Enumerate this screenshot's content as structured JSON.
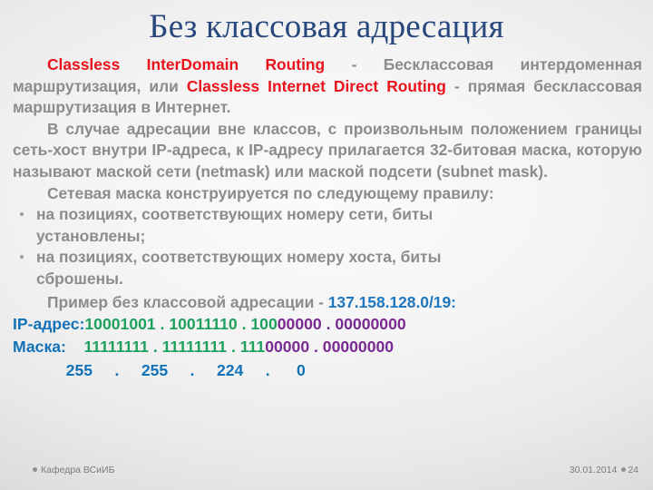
{
  "slide": {
    "title": "Без классовая адресация",
    "paragraphs": [
      {
        "id": "p1",
        "runs": [
          {
            "text": "Classless InterDomain Routing",
            "color": "red"
          },
          {
            "text": " - Бесклассовая интердоменная маршрутизация, или ",
            "color": "gray"
          },
          {
            "text": "Classless Internet Direct Routing",
            "color": "red"
          },
          {
            "text": " - прямая бесклассовая маршрутизация в Интернет.",
            "color": "gray"
          }
        ]
      },
      {
        "id": "p2",
        "text": "В случае адресации вне классов, с произвольным положением границы сеть-хост внутри IP-адреса, к IP-адресу прилагается 32-битовая маска, которую называют маской сети (netmask) или маской подсети (subnet mask)."
      },
      {
        "id": "p3",
        "text": "Сетевая маска конструируется по следующему правилу:"
      }
    ],
    "bullets": [
      {
        "main": "на позициях, соответствующих номеру сети, биты",
        "tail": "установлены;"
      },
      {
        "main": "на позициях, соответствующих номеру хоста, биты",
        "tail": "сброшены."
      }
    ],
    "example": {
      "intro_text": "Пример без классовой адресации - ",
      "intro_address": "137.158.128.0/19:",
      "ip_row": {
        "label": "IP-адрес:",
        "octet1": "10001001",
        "octet2": "10011110",
        "octet3_network": "100",
        "octet3_host": "00000",
        "octet4_host": "00000000",
        "separator": " . "
      },
      "mask_row": {
        "label": "Маска:",
        "octet1": "11111111",
        "octet2": "11111111",
        "octet3_network": "111",
        "octet3_host": "00000",
        "octet4_host": "00000000",
        "separator": " . "
      },
      "decimal_row": {
        "octet1": "255",
        "octet2": "255",
        "octet3": "224",
        "octet4": "0",
        "separator": "."
      }
    },
    "footer": {
      "department": "Кафедра ВСиИБ",
      "date": "30.01.2014",
      "slide_number": "24"
    },
    "colors": {
      "title": "#27477d",
      "body_text": "#8c8c8c",
      "highlight_red": "#e8131b",
      "label_blue": "#1272b8",
      "bits_network_green": "#1ea15c",
      "bits_host_purple": "#7a2a92",
      "footer_text": "#7b7b7b"
    }
  }
}
